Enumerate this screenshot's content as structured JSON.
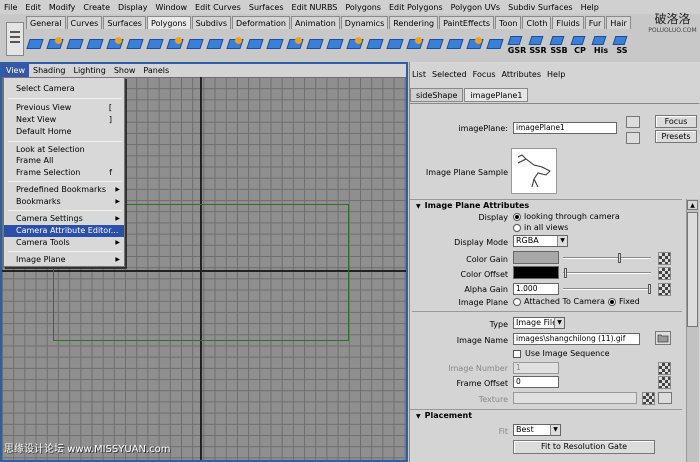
{
  "menubar": [
    "File",
    "Edit",
    "Modify",
    "Create",
    "Display",
    "Window",
    "Edit Curves",
    "Surfaces",
    "Edit NURBS",
    "Polygons",
    "Edit Polygons",
    "Polygon UVs",
    "Subdiv Surfaces",
    "Help"
  ],
  "shelf": {
    "tabs": [
      "General",
      "Curves",
      "Surfaces",
      "Polygons",
      "Subdivs",
      "Deformation",
      "Animation",
      "Dynamics",
      "Rendering",
      "PaintEffects",
      "Toon",
      "Cloth",
      "Fluids",
      "Fur",
      "Hair"
    ],
    "active_tab": "Polygons",
    "icon_labels": [
      "GSR",
      "SSR",
      "SSB",
      "CP",
      "His",
      "SS"
    ]
  },
  "logo": {
    "line1": "破洛洛",
    "line2": "POLUOLUO.COM"
  },
  "panel_menu": {
    "items": [
      "View",
      "Shading",
      "Lighting",
      "Show",
      "Panels"
    ],
    "active": "View"
  },
  "view_menu": {
    "select_camera": "Select Camera",
    "previous_view": "Previous View",
    "previous_view_key": "[",
    "next_view": "Next View",
    "next_view_key": "]",
    "default_home": "Default Home",
    "look_at_selection": "Look at Selection",
    "frame_all": "Frame All",
    "frame_selection": "Frame Selection",
    "frame_selection_key": "f",
    "predefined_bookmarks": "Predefined Bookmarks",
    "bookmarks": "Bookmarks",
    "camera_settings": "Camera Settings",
    "camera_attribute_editor": "Camera Attribute Editor...",
    "camera_tools": "Camera Tools",
    "image_plane": "Image Plane"
  },
  "attr_editor": {
    "menu": [
      "List",
      "Selected",
      "Focus",
      "Attributes",
      "Help"
    ],
    "tabs": [
      "sideShape",
      "imagePlane1"
    ],
    "active_tab": "imagePlane1",
    "node_label": "imagePlane:",
    "node_value": "imagePlane1",
    "focus_button": "Focus",
    "presets_button": "Presets",
    "sample_label": "Image Plane Sample",
    "sections": {
      "attributes": "Image Plane Attributes",
      "placement": "Placement"
    },
    "display_label": "Display",
    "display_opt1": "looking through camera",
    "display_opt2": "in all views",
    "display_mode_label": "Display Mode",
    "display_mode_value": "RGBA",
    "color_gain_label": "Color Gain",
    "color_gain_color": "#a8a8a8",
    "color_offset_label": "Color Offset",
    "color_offset_color": "#000000",
    "alpha_gain_label": "Alpha Gain",
    "alpha_gain_value": "1.000",
    "image_plane_label": "Image Plane",
    "image_plane_opt1": "Attached To Camera",
    "image_plane_opt2": "Fixed",
    "type_label": "Type",
    "type_value": "Image File",
    "image_name_label": "Image Name",
    "image_name_value": "images\\shangchilong (11).gif",
    "use_sequence_label": "Use Image Sequence",
    "image_number_label": "Image Number",
    "image_number_value": "1",
    "frame_offset_label": "Frame Offset",
    "frame_offset_value": "0",
    "texture_label": "Texture",
    "fit_label": "Fit",
    "fit_value": "Best",
    "fit_button": "Fit to Resolution Gate"
  },
  "watermark": "思缘设计论坛 www.MISSYUAN.com"
}
